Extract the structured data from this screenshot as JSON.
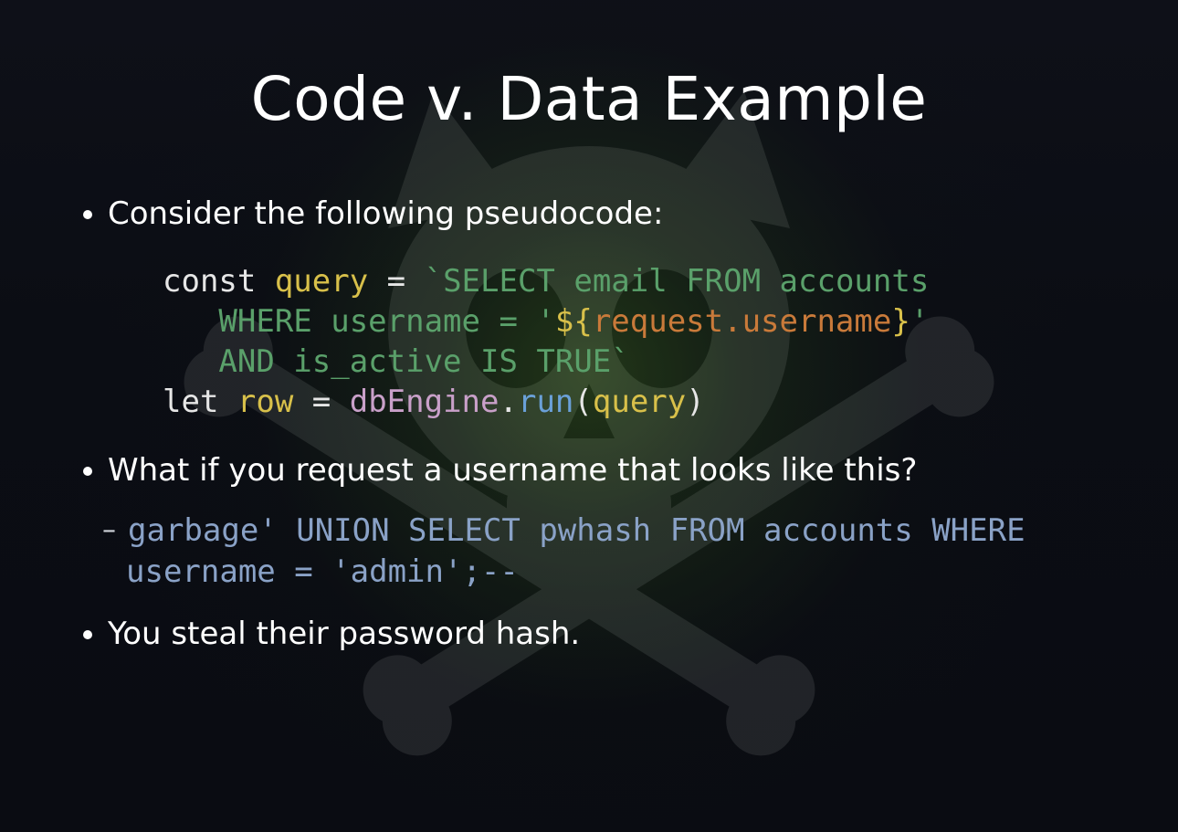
{
  "title": "Code v. Data Example",
  "bullets": {
    "b1": "Consider the following pseudocode:",
    "b2": "What if you request a username that looks like this?",
    "b3": "You steal their password hash."
  },
  "code": {
    "l1": {
      "kw": "const ",
      "var": "query",
      "op": " = ",
      "str1": "`SELECT email FROM accounts"
    },
    "l2": {
      "str1": "   WHERE username = '",
      "intpOpen": "${",
      "intv": "request.username",
      "intpClose": "}",
      "str2": "'"
    },
    "l3": {
      "str1": "   AND is_active IS TRUE`"
    },
    "l4": {
      "kw": "let ",
      "var1": "row",
      "op": " = ",
      "obj": "dbEngine",
      "dot": ".",
      "mth": "run",
      "lpar": "(",
      "arg": "query",
      "rpar": ")"
    }
  },
  "injection": "garbage' UNION SELECT pwhash FROM accounts WHERE username = 'admin';--"
}
